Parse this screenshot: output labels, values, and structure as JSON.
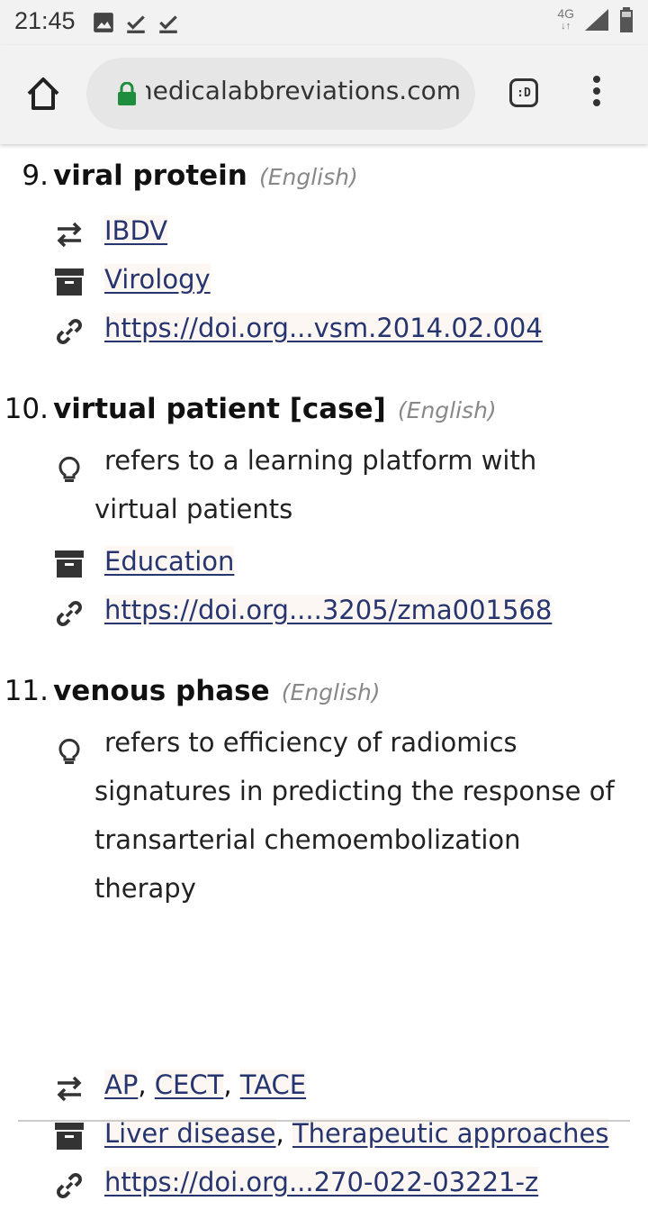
{
  "status_bar": {
    "time": "21:45",
    "left_icons": [
      "image-icon",
      "download-done-icon",
      "download-done-icon"
    ],
    "network": "4G",
    "right_icons": [
      "signal-icon",
      "battery-icon"
    ]
  },
  "browser": {
    "url": "medicalabbreviations.com",
    "tab_label": ":D",
    "icons": [
      "home-icon",
      "lock-icon",
      "tab-switcher-icon",
      "overflow-menu-icon"
    ]
  },
  "entries": [
    {
      "number": "9.",
      "term": "viral protein",
      "language": "(English)",
      "abbreviations": [
        "IBDV"
      ],
      "categories": [
        "Virology"
      ],
      "source": "https://doi.org...vsm.2014.02.004"
    },
    {
      "number": "10.",
      "term": "virtual patient [case]",
      "language": "(English)",
      "description_lines": [
        "refers to a learning platform with",
        "virtual patients"
      ],
      "categories": [
        "Education"
      ],
      "source": "https://doi.org....3205/zma001568"
    },
    {
      "number": "11.",
      "term": "venous phase",
      "language": "(English)",
      "description_lines": [
        "refers to efficiency of radiomics",
        "signatures in predicting the response of",
        "transarterial chemoembolization",
        "therapy"
      ],
      "abbreviations": [
        "AP",
        "CECT",
        "TACE"
      ],
      "categories": [
        "Liver disease",
        "Therapeutic approaches"
      ],
      "source": "https://doi.org...270-022-03221-z"
    }
  ],
  "separator": ", ",
  "colors": {
    "link": "#26356f",
    "link_bg": "#fcf7f2",
    "toolbar_bg": "#f2f2f2",
    "lock": "#1e8e3e"
  }
}
